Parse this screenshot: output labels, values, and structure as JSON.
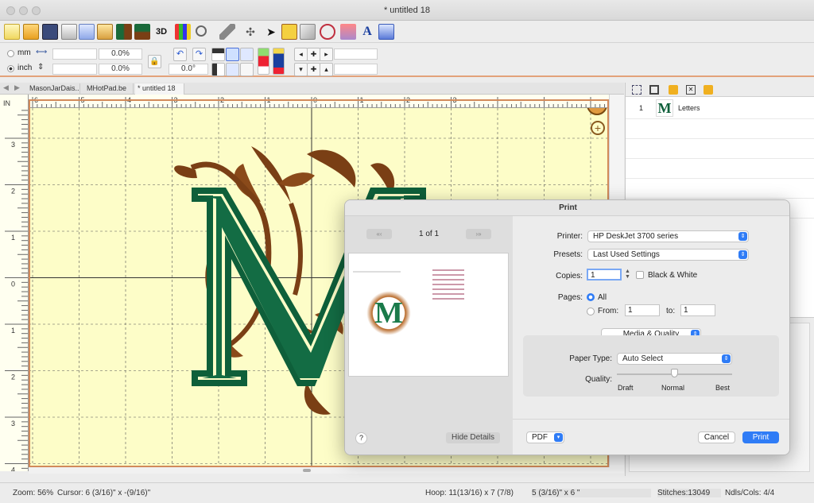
{
  "window": {
    "title": "* untitled 18"
  },
  "unit_panel": {
    "mm_label": "mm",
    "inch_label": "inch",
    "width_value": "",
    "height_value": "",
    "width_pct": "0.0%",
    "height_pct": "0.0%",
    "rotation": "0.0°"
  },
  "tabs": [
    {
      "label": "MasonJarDais..."
    },
    {
      "label": "MHotPad.be"
    },
    {
      "label": "* untitled 18"
    }
  ],
  "hruler": {
    "ticks": [
      "6",
      "5",
      "4",
      "3",
      "2",
      "1",
      "0",
      "1",
      "2",
      "3"
    ],
    "unit": "IN"
  },
  "vruler": {
    "ticks": [
      "3",
      "2",
      "1",
      "0",
      "1",
      "2",
      "3",
      "4"
    ],
    "unit": "IN"
  },
  "compass": {
    "letter": "N"
  },
  "layers": [
    {
      "number": "1",
      "name": "Letters"
    }
  ],
  "print_dialog": {
    "title": "Print",
    "page_indicator": "1 of 1",
    "printer_label": "Printer:",
    "printer_value": "HP DeskJet 3700 series",
    "presets_label": "Presets:",
    "presets_value": "Last Used Settings",
    "copies_label": "Copies:",
    "copies_value": "1",
    "bw_label": "Black & White",
    "pages_label": "Pages:",
    "all_label": "All",
    "from_label": "From:",
    "from_value": "1",
    "to_label": "to:",
    "to_value": "1",
    "section_value": "Media & Quality",
    "paper_type_label": "Paper Type:",
    "paper_type_value": "Auto Select",
    "quality_label": "Quality:",
    "quality_draft": "Draft",
    "quality_normal": "Normal",
    "quality_best": "Best",
    "help_label": "?",
    "hide_details_label": "Hide Details",
    "pdf_label": "PDF",
    "cancel_label": "Cancel",
    "print_label": "Print"
  },
  "status": {
    "zoom": "Zoom: 56%",
    "cursor": "Cursor: 6 (3/16)\" x -(9/16)\"",
    "hoop": "Hoop: 11(13/16) x 7 (7/8)",
    "size": "5 (3/16)\" x 6 \"",
    "stitches": "Stitches:13049",
    "ndls": "Ndls/Cols: 4/4"
  },
  "colors": {
    "accent": "#2f7cf6",
    "canvas": "#fdfdc8",
    "hoop_border": "#d28a5a",
    "thread_green": "#0e5f3a",
    "thread_brown": "#7a3f15"
  }
}
